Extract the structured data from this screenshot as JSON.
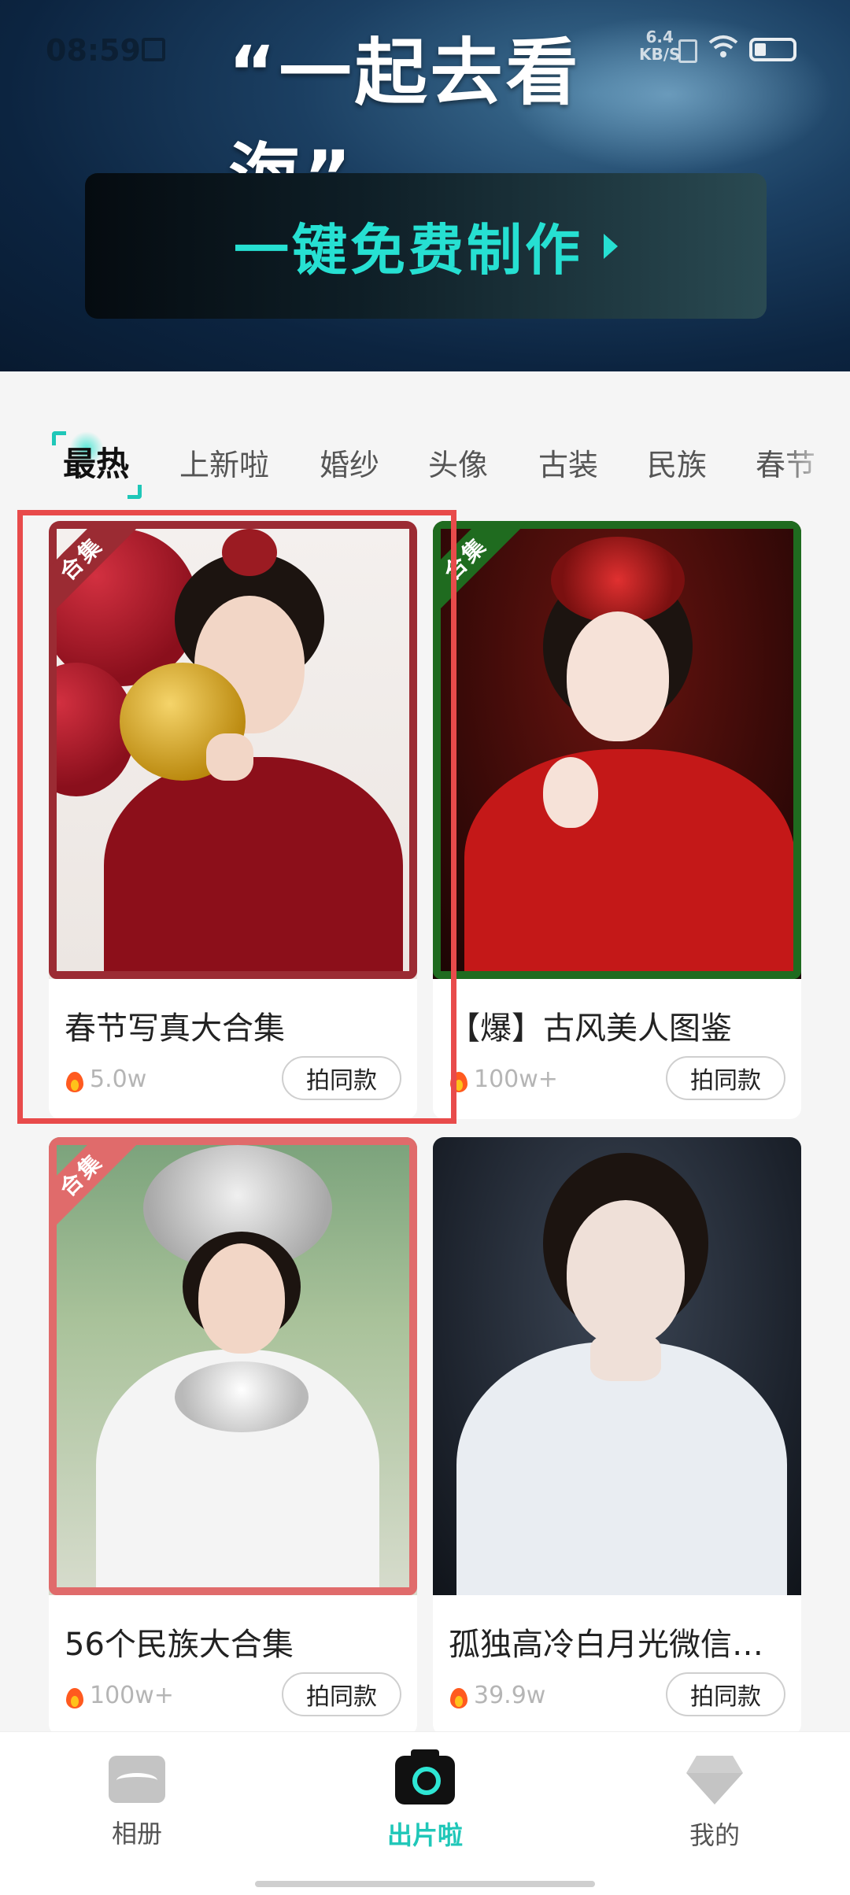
{
  "status_bar": {
    "time": "08:59",
    "net_speed_value": "6.4",
    "net_speed_unit": "KB/S"
  },
  "banner": {
    "title": "“一起去看海”",
    "cta_label": "一键免费制作"
  },
  "tabs": [
    {
      "label": "最热",
      "active": true
    },
    {
      "label": "上新啦",
      "active": false
    },
    {
      "label": "婚纱",
      "active": false
    },
    {
      "label": "头像",
      "active": false
    },
    {
      "label": "古装",
      "active": false
    },
    {
      "label": "民族",
      "active": false
    },
    {
      "label": "春节",
      "active": false
    }
  ],
  "cards": [
    {
      "title": "春节写真大合集",
      "count": "5.0w",
      "button": "拍同款",
      "badge": "合集",
      "frame_color": "#9b2b33"
    },
    {
      "title": "【爆】古风美人图鉴",
      "count": "100w+",
      "button": "拍同款",
      "badge": "合集",
      "frame_color": "#1f6b1f"
    },
    {
      "title": "56个民族大合集",
      "count": "100w+",
      "button": "拍同款",
      "badge": "合集",
      "frame_color": "#e06b6b"
    },
    {
      "title": "孤独高冷白月光微信…",
      "count": "39.9w",
      "button": "拍同款",
      "badge": "",
      "frame_color": ""
    }
  ],
  "bottom_nav": [
    {
      "label": "相册",
      "icon": "album-icon",
      "active": false
    },
    {
      "label": "出片啦",
      "icon": "camera-icon",
      "active": true
    },
    {
      "label": "我的",
      "icon": "gem-icon",
      "active": false
    }
  ],
  "colors": {
    "accent": "#1fc7b8",
    "cta_text": "#26e0d2",
    "highlight": "#e84b4b",
    "fire": "#ff5a1f"
  }
}
